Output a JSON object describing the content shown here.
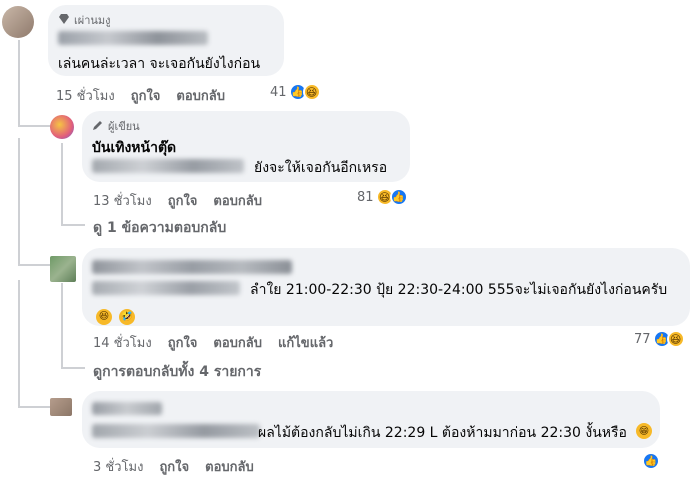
{
  "comments": [
    {
      "badge": "เผ่านมงู",
      "text": "เล่นคนล่ะเวลา จะเจอกันยังไงก่อน",
      "time": "15 ชั่วโมง",
      "like": "ถูกใจ",
      "reply": "ตอบกลับ",
      "reaction_count": "41"
    },
    {
      "badge": "ผู้เขียน",
      "author": "บันเทิงหน้าตุ๊ด",
      "text": "ยังจะให้เจอกันอีกเหรอ",
      "time": "13 ชั่วโมง",
      "like": "ถูกใจ",
      "reply": "ตอบกลับ",
      "reaction_count": "81",
      "view_replies": "ดู 1 ข้อความตอบกลับ"
    },
    {
      "text": "ลำใย 21:00-22:30 ปุ้ย 22:30-24:00 555จะไม่เจอกันยังไงก่อนครับ",
      "time": "14 ชั่วโมง",
      "like": "ถูกใจ",
      "reply": "ตอบกลับ",
      "edited": "แก้ไขแล้ว",
      "reaction_count": "77",
      "view_replies": "ดูการตอบกลับทั้ง 4 รายการ"
    },
    {
      "text": "ผลไม้ต้องกลับไม่เกิน 22:29 L ต้องห้ามมาก่อน 22:30 งั้นหรือ",
      "time": "3 ชั่วโมง",
      "like": "ถูกใจ",
      "reply": "ตอบกลับ"
    }
  ],
  "icons": {
    "diamond": "diamond-icon",
    "pencil": "pencil-icon",
    "like": "like-reaction-icon",
    "haha": "haha-reaction-icon"
  },
  "colors": {
    "bubble": "#f0f2f5",
    "meta": "#65676b",
    "like": "#1877f2",
    "haha": "#f7b928"
  }
}
